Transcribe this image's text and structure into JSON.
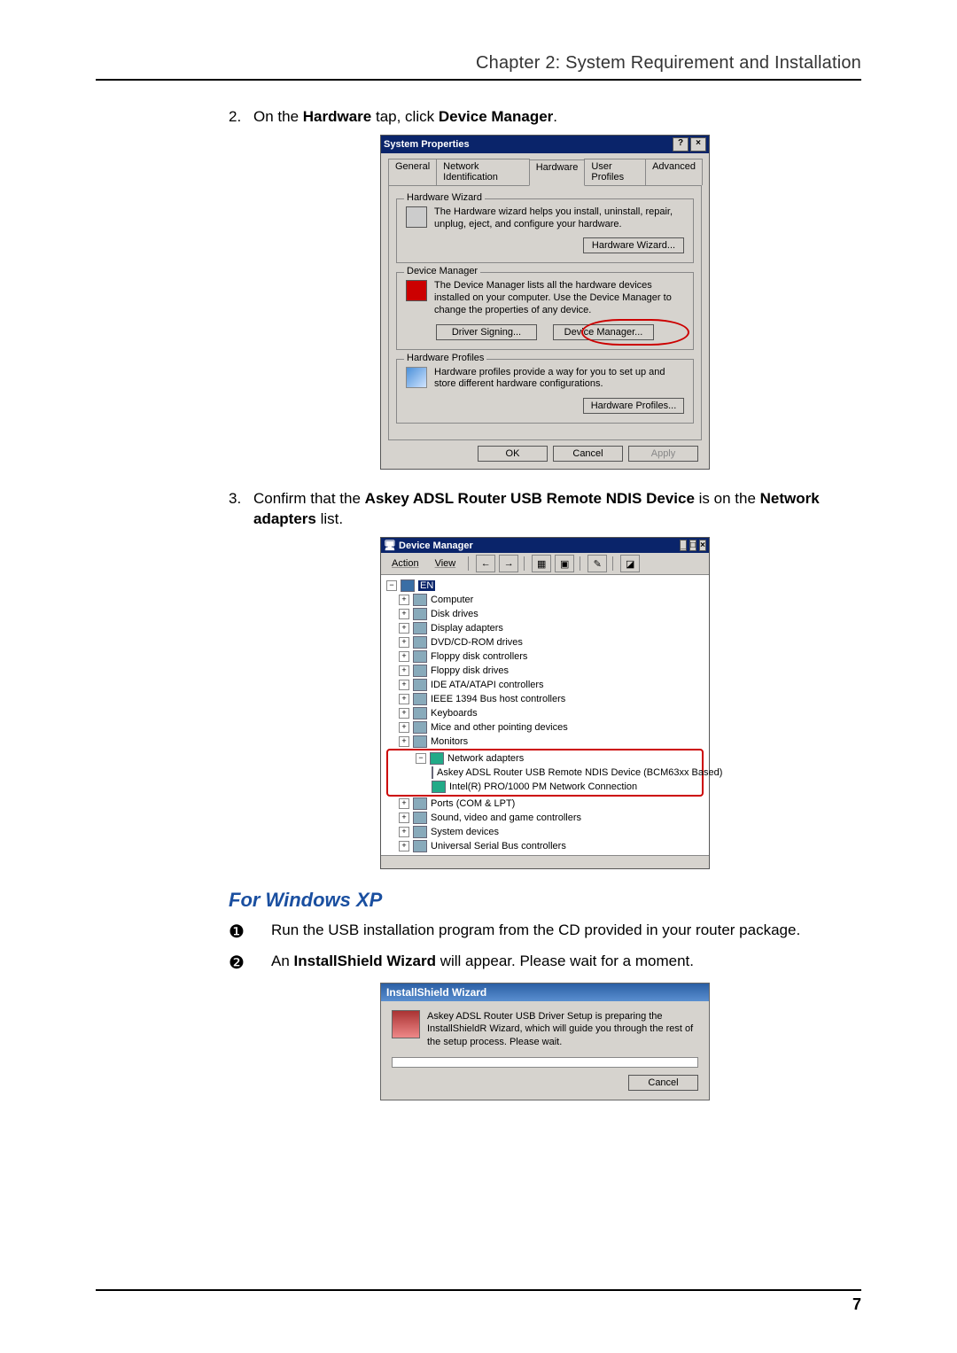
{
  "chapter_heading": "Chapter 2: System Requirement and Installation",
  "page_number": "7",
  "step2": {
    "num": "2.",
    "pre": "On the ",
    "b1": "Hardware",
    "mid": " tap, click ",
    "b2": "Device Manager",
    "post": "."
  },
  "step3": {
    "num": "3.",
    "pre": "Confirm that the ",
    "b1": "Askey ADSL Router USB Remote NDIS Device",
    "mid": " is on the ",
    "b2": "Network adapters",
    "post": " list."
  },
  "subhead": "For Windows XP",
  "xp_steps": {
    "s1": {
      "badge": "❶",
      "text": "Run the USB installation program from the CD provided in your router package."
    },
    "s2": {
      "badge": "❷",
      "pre": "An ",
      "b": "InstallShield Wizard",
      "post": " will appear. Please wait for a moment."
    }
  },
  "sp_dialog": {
    "title": "System Properties",
    "close": "×",
    "help": "?",
    "tabs": {
      "general": "General",
      "netid": "Network Identification",
      "hardware": "Hardware",
      "profiles": "User Profiles",
      "advanced": "Advanced"
    },
    "hw_wiz": {
      "legend": "Hardware Wizard",
      "text": "The Hardware wizard helps you install, uninstall, repair, unplug, eject, and configure your hardware.",
      "button": "Hardware Wizard..."
    },
    "dev_mgr": {
      "legend": "Device Manager",
      "text": "The Device Manager lists all the hardware devices installed on your computer. Use the Device Manager to change the properties of any device.",
      "btn_sign": "Driver Signing...",
      "btn_mgr": "Device Manager..."
    },
    "hw_prof": {
      "legend": "Hardware Profiles",
      "text": "Hardware profiles provide a way for you to set up and store different hardware configurations.",
      "button": "Hardware Profiles..."
    },
    "footer": {
      "ok": "OK",
      "cancel": "Cancel",
      "apply": "Apply"
    }
  },
  "dm_window": {
    "title": "Device Manager",
    "menu": {
      "action": "Action",
      "view": "View"
    },
    "root": "EN",
    "nodes": [
      "Computer",
      "Disk drives",
      "Display adapters",
      "DVD/CD-ROM drives",
      "Floppy disk controllers",
      "Floppy disk drives",
      "IDE ATA/ATAPI controllers",
      "IEEE 1394 Bus host controllers",
      "Keyboards",
      "Mice and other pointing devices",
      "Monitors"
    ],
    "net": {
      "label": "Network adapters",
      "c1": "Askey ADSL Router USB Remote NDIS Device (BCM63xx Based)",
      "c2": "Intel(R) PRO/1000 PM Network Connection"
    },
    "nodes2": [
      "Ports (COM & LPT)",
      "Sound, video and game controllers",
      "System devices",
      "Universal Serial Bus controllers"
    ]
  },
  "is_dialog": {
    "title": "InstallShield Wizard",
    "text": "Askey ADSL Router USB Driver Setup is preparing the InstallShieldR Wizard, which will guide you through the rest of the setup process. Please wait.",
    "cancel": "Cancel"
  }
}
